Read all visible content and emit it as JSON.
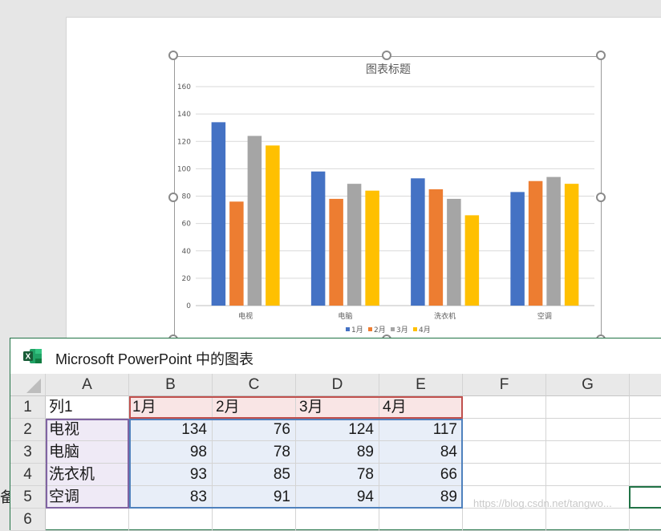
{
  "background_text": "备注",
  "chart_data": {
    "type": "bar",
    "title": "图表标题",
    "categories": [
      "电视",
      "电脑",
      "洗衣机",
      "空调"
    ],
    "series": [
      {
        "name": "1月",
        "values": [
          134,
          98,
          93,
          83
        ],
        "color": "#4472c4"
      },
      {
        "name": "2月",
        "values": [
          76,
          78,
          85,
          91
        ],
        "color": "#ed7d31"
      },
      {
        "name": "3月",
        "values": [
          124,
          89,
          78,
          94
        ],
        "color": "#a5a5a5"
      },
      {
        "name": "4月",
        "values": [
          117,
          84,
          66,
          89
        ],
        "color": "#ffc000"
      }
    ],
    "ylim": [
      0,
      160
    ],
    "yticks": [
      0,
      20,
      40,
      60,
      80,
      100,
      120,
      140,
      160
    ],
    "grid": true,
    "legend": "bottom"
  },
  "excel": {
    "title": "Microsoft PowerPoint 中的图表",
    "columns": [
      "A",
      "B",
      "C",
      "D",
      "E",
      "F",
      "G"
    ],
    "row_numbers": [
      "1",
      "2",
      "3",
      "4",
      "5",
      "6"
    ],
    "header_row": [
      "列1",
      "1月",
      "2月",
      "3月",
      "4月"
    ],
    "rows": [
      [
        "电视",
        "134",
        "76",
        "124",
        "117"
      ],
      [
        "电脑",
        "98",
        "78",
        "89",
        "84"
      ],
      [
        "洗衣机",
        "93",
        "85",
        "78",
        "66"
      ],
      [
        "空调",
        "83",
        "91",
        "94",
        "89"
      ]
    ]
  },
  "watermark": "https://blog.csdn.net/tangwo..."
}
